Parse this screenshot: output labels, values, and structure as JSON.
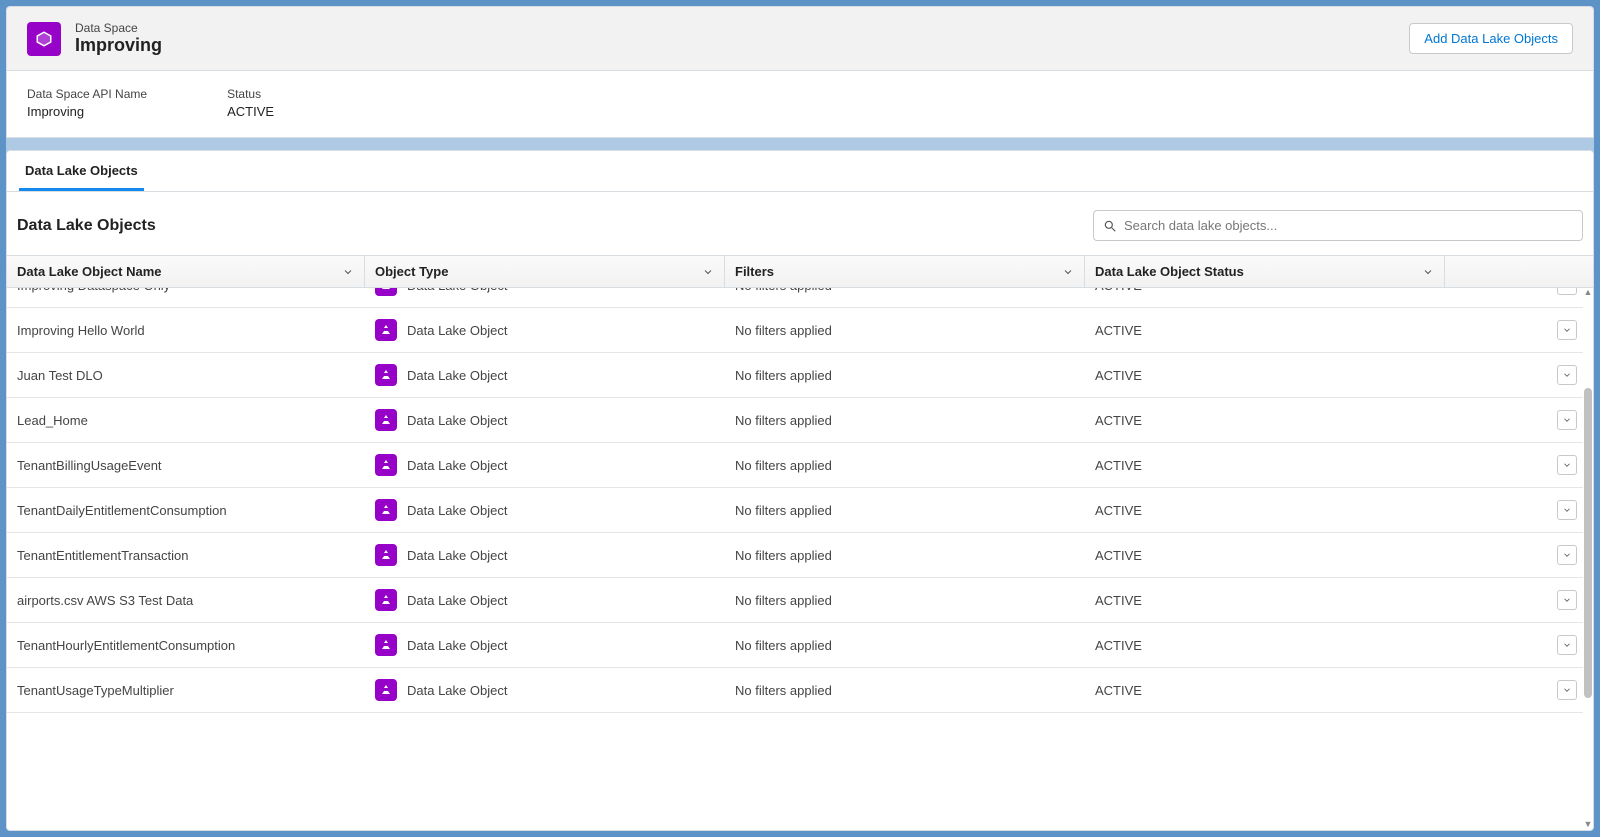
{
  "header": {
    "eyebrow": "Data Space",
    "title": "Improving",
    "action_label": "Add Data Lake Objects"
  },
  "details": {
    "api_name_label": "Data Space API Name",
    "api_name_value": "Improving",
    "status_label": "Status",
    "status_value": "ACTIVE"
  },
  "tabs": {
    "data_lake_objects": "Data Lake Objects"
  },
  "list": {
    "heading": "Data Lake Objects",
    "search_placeholder": "Search data lake objects..."
  },
  "columns": {
    "name": "Data Lake Object Name",
    "type": "Object Type",
    "filters": "Filters",
    "status": "Data Lake Object Status"
  },
  "row_type_label": "Data Lake Object",
  "row_filters_label": "No filters applied",
  "row_status_label": "ACTIVE",
  "rows": [
    {
      "name": "Improving Dataspace Only"
    },
    {
      "name": "Improving Hello World"
    },
    {
      "name": "Juan Test DLO"
    },
    {
      "name": "Lead_Home"
    },
    {
      "name": "TenantBillingUsageEvent"
    },
    {
      "name": "TenantDailyEntitlementConsumption"
    },
    {
      "name": "TenantEntitlementTransaction"
    },
    {
      "name": "airports.csv AWS S3 Test Data"
    },
    {
      "name": "TenantHourlyEntitlementConsumption"
    },
    {
      "name": "TenantUsageTypeMultiplier"
    }
  ]
}
